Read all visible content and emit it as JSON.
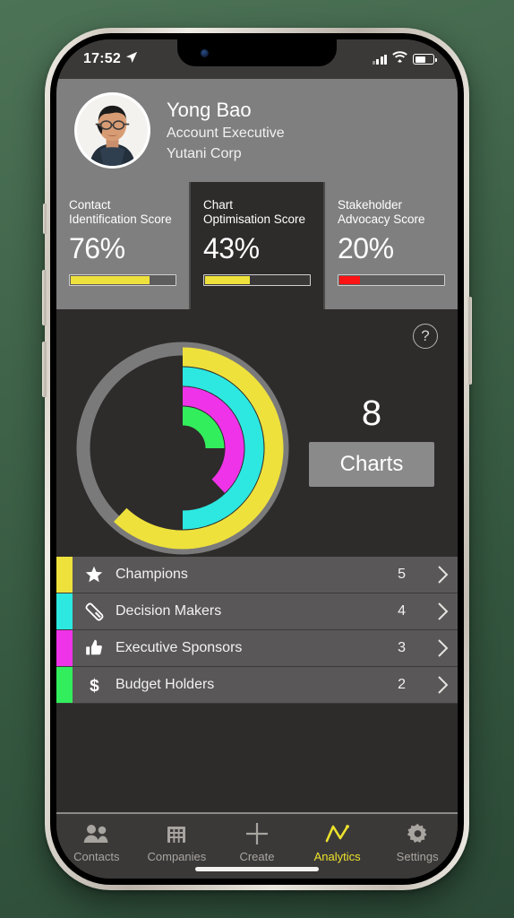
{
  "status_bar": {
    "time": "17:52",
    "location_icon": "location-arrow-icon",
    "signal_icon": "cellular-signal-icon",
    "wifi_icon": "wifi-icon",
    "battery_icon": "battery-icon"
  },
  "profile": {
    "avatar": "user-avatar-photo",
    "name": "Yong Bao",
    "role": "Account Executive",
    "company": "Yutani Corp"
  },
  "score_cards": [
    {
      "title": "Contact\nIdentification Score",
      "title_line1": "Contact",
      "title_line2": "Identification Score",
      "value": "76%",
      "percent": 76,
      "bar_color": "#eee13c",
      "active": false
    },
    {
      "title": "Chart\nOptimisation Score",
      "title_line1": "Chart",
      "title_line2": "Optimisation Score",
      "value": "43%",
      "percent": 43,
      "bar_color": "#eee13c",
      "active": true
    },
    {
      "title": "Stakeholder\nAdvocacy Score",
      "title_line1": "Stakeholder",
      "title_line2": "Advocacy Score",
      "value": "20%",
      "percent": 20,
      "bar_color": "#fc1414",
      "active": false
    }
  ],
  "chart_panel": {
    "help_icon": "question-mark-icon",
    "help_label": "?",
    "count": "8",
    "count_button_label": "Charts"
  },
  "chart_data": {
    "type": "pie",
    "subtype": "multi-ring-radial-progress",
    "title": "Stakeholder coverage rings",
    "track_color": "#7a7a7a",
    "background": "#2e2b2b",
    "series": [
      {
        "name": "Champions",
        "ring": 1,
        "value": 62,
        "color": "#eee13c"
      },
      {
        "name": "Decision Makers",
        "ring": 2,
        "value": 50,
        "color": "#2ce8e0"
      },
      {
        "name": "Executive Sponsors",
        "ring": 3,
        "value": 38,
        "color": "#ef33e8"
      },
      {
        "name": "Budget Holders",
        "ring": 4,
        "value": 25,
        "color": "#33ee5c"
      }
    ],
    "units": "percent of ring swept clockwise from 12 o'clock",
    "legend": "rows-below"
  },
  "list": {
    "rows": [
      {
        "label": "Champions",
        "count": "5",
        "color": "#eee13c",
        "icon": "star-icon",
        "chevron": "chevron-right-icon"
      },
      {
        "label": "Decision Makers",
        "count": "4",
        "color": "#2ce8e0",
        "icon": "gem-icon",
        "chevron": "chevron-right-icon"
      },
      {
        "label": "Executive Sponsors",
        "count": "3",
        "color": "#ef33e8",
        "icon": "thumbs-up-icon",
        "chevron": "chevron-right-icon"
      },
      {
        "label": "Budget Holders",
        "count": "2",
        "color": "#33ee5c",
        "icon": "dollar-icon",
        "chevron": "chevron-right-icon"
      }
    ]
  },
  "tab_bar": {
    "active_color": "#ece22c",
    "tabs": [
      {
        "label": "Contacts",
        "icon": "contacts-icon",
        "active": false
      },
      {
        "label": "Companies",
        "icon": "building-icon",
        "active": false
      },
      {
        "label": "Create",
        "icon": "plus-icon",
        "active": false
      },
      {
        "label": "Analytics",
        "icon": "line-chart-icon",
        "active": true
      },
      {
        "label": "Settings",
        "icon": "gear-icon",
        "active": false
      }
    ]
  }
}
